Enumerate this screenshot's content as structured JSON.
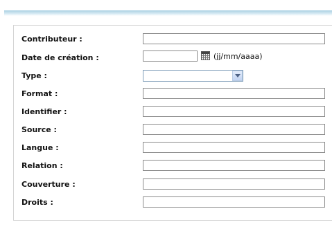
{
  "form": {
    "fields": [
      {
        "key": "contributeur",
        "label": "Contributeur :",
        "value": ""
      },
      {
        "key": "date_creation",
        "label": "Date de création :",
        "value": "",
        "hint": "(jj/mm/aaaa)"
      },
      {
        "key": "type",
        "label": "Type :",
        "selected": ""
      },
      {
        "key": "format",
        "label": "Format :",
        "value": ""
      },
      {
        "key": "identifier",
        "label": "Identifier :",
        "value": ""
      },
      {
        "key": "source",
        "label": "Source :",
        "value": ""
      },
      {
        "key": "langue",
        "label": "Langue :",
        "value": ""
      },
      {
        "key": "relation",
        "label": "Relation :",
        "value": ""
      },
      {
        "key": "couverture",
        "label": "Couverture :",
        "value": ""
      },
      {
        "key": "droits",
        "label": "Droits :",
        "value": ""
      }
    ]
  },
  "icons": {
    "calendar": "calendar-icon",
    "dropdown": "chevron-down-icon"
  },
  "colors": {
    "band": "#a9cfe2",
    "select_border": "#7f9db9",
    "field_border": "#8a8a8a"
  }
}
